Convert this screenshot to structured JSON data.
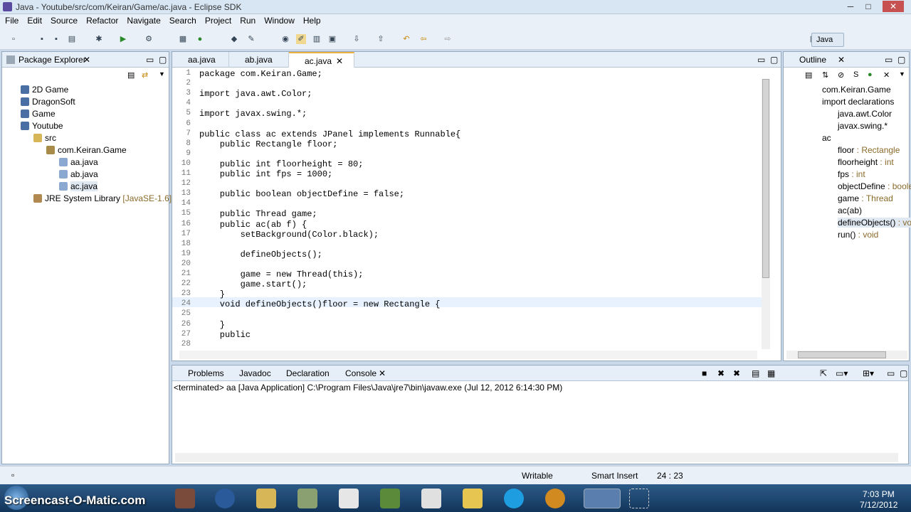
{
  "window": {
    "title": "Java - Youtube/src/com/Keiran/Game/ac.java - Eclipse SDK"
  },
  "menus": [
    "File",
    "Edit",
    "Source",
    "Refactor",
    "Navigate",
    "Search",
    "Project",
    "Run",
    "Window",
    "Help"
  ],
  "perspective": "Java",
  "package_explorer": {
    "title": "Package Explorer",
    "items": [
      {
        "label": "2D Game"
      },
      {
        "label": "DragonSoft"
      },
      {
        "label": "Game"
      },
      {
        "label": "Youtube"
      },
      {
        "label": "src"
      },
      {
        "label": "com.Keiran.Game"
      },
      {
        "label": "aa.java"
      },
      {
        "label": "ab.java"
      },
      {
        "label": "ac.java"
      },
      {
        "label": "JRE System Library",
        "extra": "[JavaSE-1.6]"
      }
    ]
  },
  "editor": {
    "tabs": [
      "aa.java",
      "ab.java",
      "ac.java"
    ],
    "lines": [
      {
        "n": "1",
        "t": "package com.Keiran.Game;"
      },
      {
        "n": "2",
        "t": ""
      },
      {
        "n": "3",
        "t": "import java.awt.Color;"
      },
      {
        "n": "4",
        "t": ""
      },
      {
        "n": "5",
        "t": "import javax.swing.*;"
      },
      {
        "n": "6",
        "t": ""
      },
      {
        "n": "7",
        "t": "public class ac extends JPanel implements Runnable{"
      },
      {
        "n": "8",
        "t": "    public Rectangle floor;"
      },
      {
        "n": "9",
        "t": ""
      },
      {
        "n": "10",
        "t": "    public int floorheight = 80;"
      },
      {
        "n": "11",
        "t": "    public int fps = 1000;"
      },
      {
        "n": "12",
        "t": ""
      },
      {
        "n": "13",
        "t": "    public boolean objectDefine = false;"
      },
      {
        "n": "14",
        "t": ""
      },
      {
        "n": "15",
        "t": "    public Thread game;"
      },
      {
        "n": "16",
        "t": "    public ac(ab f) {"
      },
      {
        "n": "17",
        "t": "        setBackground(Color.black);"
      },
      {
        "n": "18",
        "t": ""
      },
      {
        "n": "19",
        "t": "        defineObjects();"
      },
      {
        "n": "20",
        "t": ""
      },
      {
        "n": "21",
        "t": "        game = new Thread(this);"
      },
      {
        "n": "22",
        "t": "        game.start();"
      },
      {
        "n": "23",
        "t": "    }"
      },
      {
        "n": "24",
        "t": "    void defineObjects()floor = new Rectangle {"
      },
      {
        "n": "25",
        "t": ""
      },
      {
        "n": "26",
        "t": "    }"
      },
      {
        "n": "27",
        "t": "    public"
      },
      {
        "n": "28",
        "t": ""
      }
    ]
  },
  "outline": {
    "title": "Outline",
    "items": [
      {
        "label": "com.Keiran.Game",
        "type": ""
      },
      {
        "label": "import declarations",
        "type": ""
      },
      {
        "label": "java.awt.Color",
        "type": ""
      },
      {
        "label": "javax.swing.*",
        "type": ""
      },
      {
        "label": "ac",
        "type": ""
      },
      {
        "label": "floor",
        "type": " : Rectangle"
      },
      {
        "label": "floorheight",
        "type": " : int"
      },
      {
        "label": "fps",
        "type": " : int"
      },
      {
        "label": "objectDefine",
        "type": " : boole"
      },
      {
        "label": "game",
        "type": " : Thread"
      },
      {
        "label": "ac(ab)",
        "type": ""
      },
      {
        "label": "defineObjects()",
        "type": " : vo"
      },
      {
        "label": "run()",
        "type": " : void"
      }
    ]
  },
  "bottom": {
    "tabs": [
      "Problems",
      "Javadoc",
      "Declaration",
      "Console"
    ],
    "console_header": "<terminated> aa [Java Application] C:\\Program Files\\Java\\jre7\\bin\\javaw.exe (Jul 12, 2012 6:14:30 PM)"
  },
  "status": {
    "writable": "Writable",
    "insert": "Smart Insert",
    "position": "24 : 23"
  },
  "taskbar": {
    "watermark": "Screencast-O-Matic.com",
    "time": "7:03 PM",
    "date": "7/12/2012"
  }
}
